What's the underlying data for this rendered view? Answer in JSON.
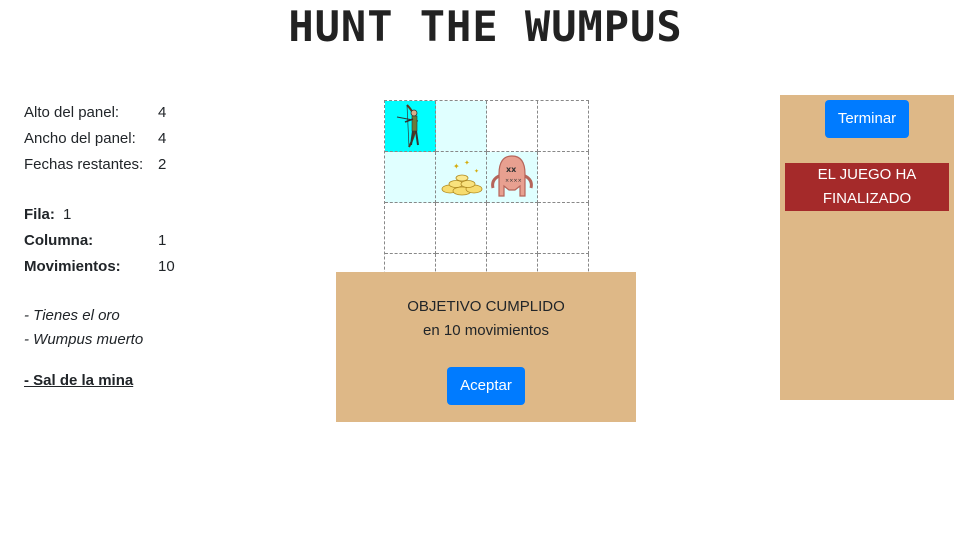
{
  "title": "HUNT THE WUMPUS",
  "info": {
    "alto_label": "Alto del panel:",
    "alto_value": "4",
    "ancho_label": "Ancho del panel:",
    "ancho_value": "4",
    "flechas_label": "Fechas restantes:",
    "flechas_value": "2",
    "fila_label": "Fila:",
    "fila_value": "1",
    "columna_label": "Columna:",
    "columna_value": "1",
    "mov_label": "Movimientos:",
    "mov_value": "10",
    "status": [
      "- Tienes el oro",
      "- Wumpus muerto"
    ],
    "exit_link": "- Sal de la mina"
  },
  "board": {
    "rows": 4,
    "cols": 4,
    "hunter_cell": "row 1, col 1",
    "gold_cell": "row 2, col 2",
    "dead_wumpus_cell": "row 2, col 3",
    "colors": {
      "current": "#00ffff",
      "visited": "#e0ffff"
    }
  },
  "modal": {
    "line1": "OBJETIVO CUMPLIDO",
    "line2": "en 10 movimientos",
    "button": "Aceptar"
  },
  "side": {
    "button": "Terminar",
    "banner": "EL JUEGO HA FINALIZADO"
  },
  "colors": {
    "panel": "#deb887",
    "button": "#007bff",
    "banner": "#a52a2a"
  }
}
